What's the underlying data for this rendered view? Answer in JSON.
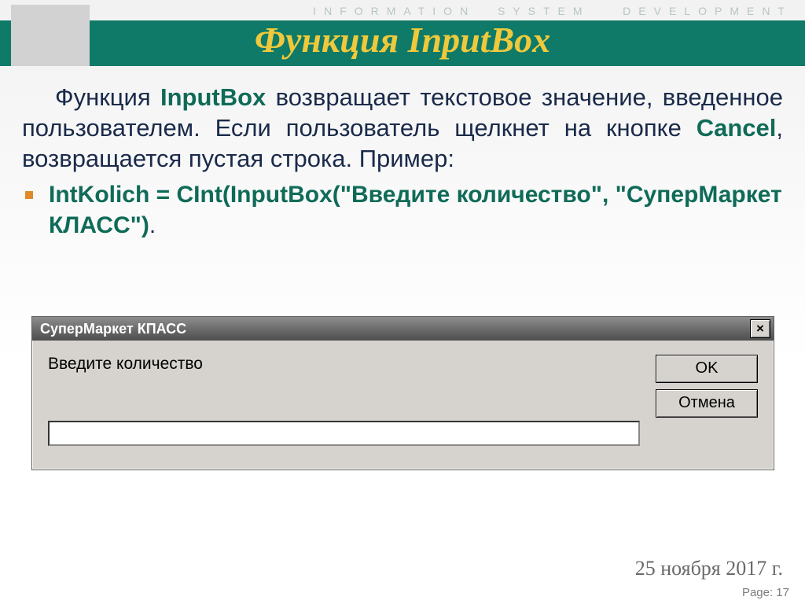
{
  "header": {
    "tracery": "INFORMATION  SYSTEM   DEVELOPMENT",
    "title": "Функция InputBox"
  },
  "body": {
    "para_pre": "Функция ",
    "para_kw1": "InputBox",
    "para_mid": " возвращает текстовое значение, введенное пользователем. Если пользователь щелкнет на кнопке ",
    "para_kw2": "Cancel",
    "para_post": ", возвращается пустая строка. Пример:",
    "bullet_code": "IntKolich = CInt(InputBox(\"Введите количество\", \"СуперМаркет КЛАСС\")",
    "bullet_dot": "."
  },
  "dialog": {
    "title": "СуперМаркет КПАСС",
    "close_glyph": "×",
    "prompt": "Введите количество",
    "ok_label": "OK",
    "cancel_label": "Отмена"
  },
  "footer": {
    "date": "25 ноября 2017 г.",
    "page": "Page: 17"
  }
}
